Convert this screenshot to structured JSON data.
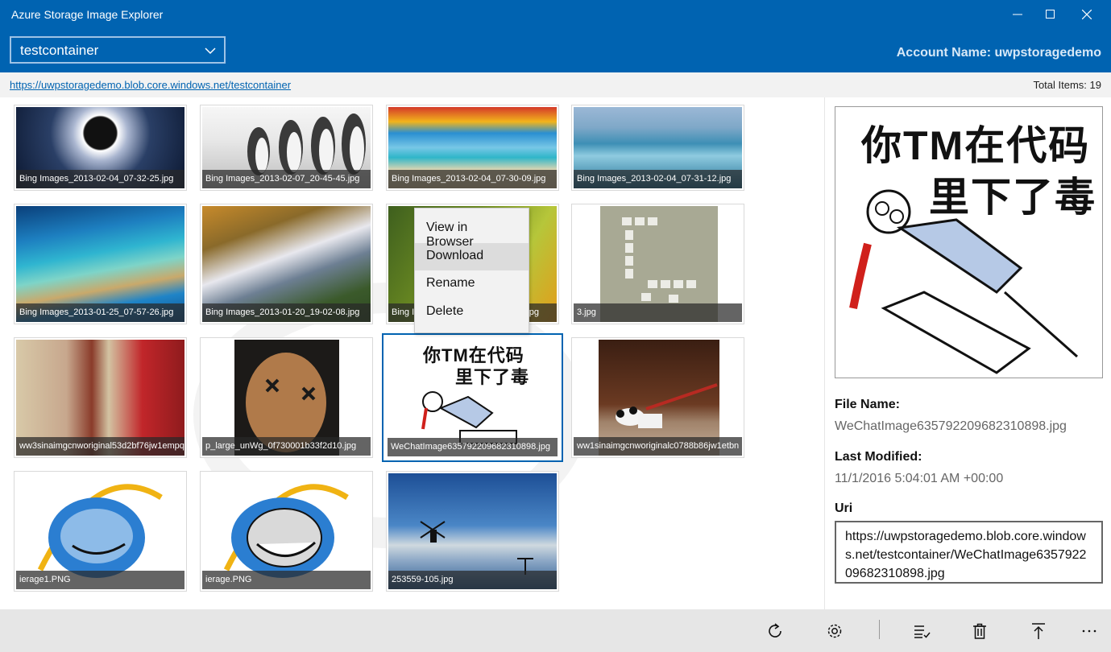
{
  "window": {
    "title": "Azure Storage Image Explorer"
  },
  "header": {
    "container": "testcontainer",
    "account": "Account Name: uwpstoragedemo"
  },
  "urlbar": {
    "url": "https://uwpstoragedemo.blob.core.windows.net/testcontainer",
    "total": "Total Items: 19"
  },
  "tiles": [
    {
      "caption": "Bing Images_2013-02-04_07-32-25.jpg"
    },
    {
      "caption": "Bing Images_2013-02-07_20-45-45.jpg"
    },
    {
      "caption": "Bing Images_2013-02-04_07-30-09.jpg"
    },
    {
      "caption": "Bing Images_2013-02-04_07-31-12.jpg"
    },
    {
      "caption": "Bing Images_2013-01-25_07-57-26.jpg"
    },
    {
      "caption": "Bing Images_2013-01-20_19-02-08.jpg"
    },
    {
      "caption": "Bing Im",
      "caption_tail": "jpg"
    },
    {
      "caption": "3.jpg"
    },
    {
      "caption": "ww3sinaimgcnworiginal53d2bf76jw1empq"
    },
    {
      "caption": "p_large_unWg_0f730001b33f2d10.jpg"
    },
    {
      "caption": "WeChatImage635792209682310898.jpg"
    },
    {
      "caption": "ww1sinaimgcnworiginalc0788b86jw1etbn"
    },
    {
      "caption": "ierage1.PNG"
    },
    {
      "caption": "ierage.PNG"
    },
    {
      "caption": "253559-105.jpg"
    }
  ],
  "context_menu": {
    "items": [
      "View in Browser",
      "Download",
      "Rename",
      "Delete"
    ]
  },
  "preview_text": {
    "line1": "你TM在代码",
    "line2": "里下了毒"
  },
  "details": {
    "file_name_label": "File Name:",
    "file_name": "WeChatImage635792209682310898.jpg",
    "modified_label": "Last Modified:",
    "modified": "11/1/2016 5:04:01 AM +00:00",
    "uri_label": "Uri",
    "uri": "https://uwpstoragedemo.blob.core.windows.net/testcontainer/WeChatImage635792209682310898.jpg"
  },
  "icons": [
    "refresh-icon",
    "settings-icon",
    "select-icon",
    "delete-icon",
    "upload-icon",
    "more-icon"
  ],
  "colors": {
    "accent": "#0063b1",
    "appbar": "#e6e6e6"
  }
}
